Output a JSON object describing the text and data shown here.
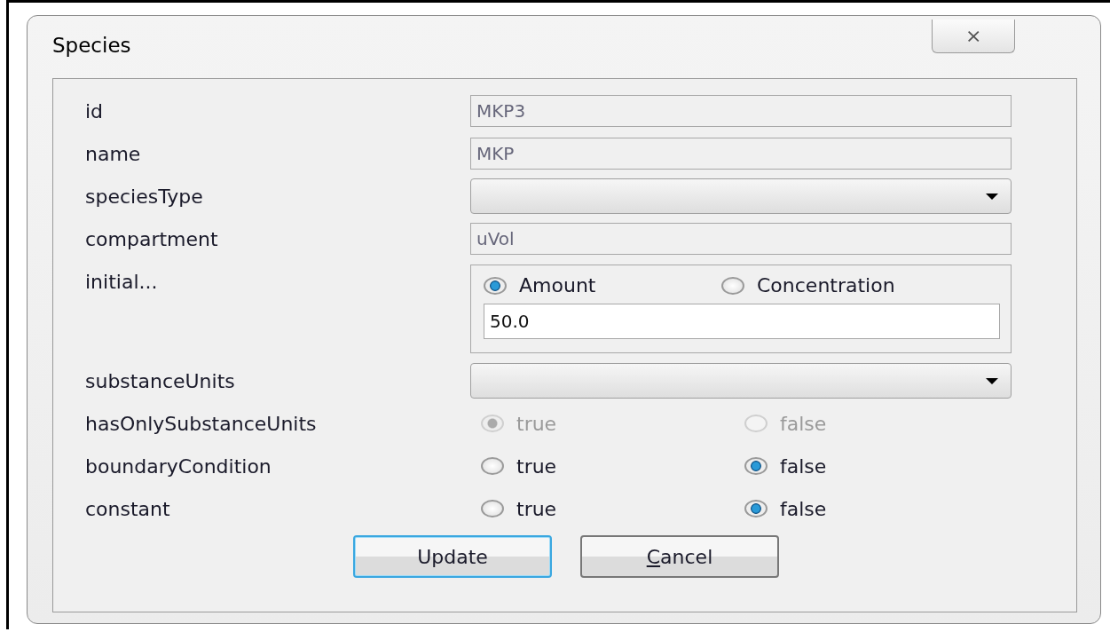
{
  "window": {
    "title": "Species",
    "close": "⨯"
  },
  "fields": [
    {
      "label": "id",
      "kind": "text",
      "value": "MKP3",
      "disabled": true
    },
    {
      "label": "name",
      "kind": "text",
      "value": "MKP",
      "disabled": true
    },
    {
      "label": "speciesType",
      "kind": "combo"
    },
    {
      "label": "compartment",
      "kind": "text",
      "value": "uVol",
      "disabled": true
    },
    {
      "label": "initial...",
      "kind": "initial",
      "options": [
        {
          "label": "Amount",
          "selected": true
        },
        {
          "label": "Concentration",
          "selected": false
        }
      ],
      "value": "50.0"
    },
    {
      "label": "substanceUnits",
      "kind": "combo"
    },
    {
      "label": "hasOnlySubstanceUnits",
      "kind": "radio",
      "disabled": true,
      "options": [
        {
          "label": "true",
          "selected": true
        },
        {
          "label": "false",
          "selected": false
        }
      ]
    },
    {
      "label": "boundaryCondition",
      "kind": "radio",
      "disabled": false,
      "options": [
        {
          "label": "true",
          "selected": false
        },
        {
          "label": "false",
          "selected": true
        }
      ]
    },
    {
      "label": "constant",
      "kind": "radio",
      "disabled": false,
      "options": [
        {
          "label": "true",
          "selected": false
        },
        {
          "label": "false",
          "selected": true
        }
      ]
    }
  ],
  "buttons": [
    {
      "label": "Update",
      "default": true,
      "mnemonic": false
    },
    {
      "label": "Cancel",
      "default": false,
      "mnemonic": true
    }
  ]
}
